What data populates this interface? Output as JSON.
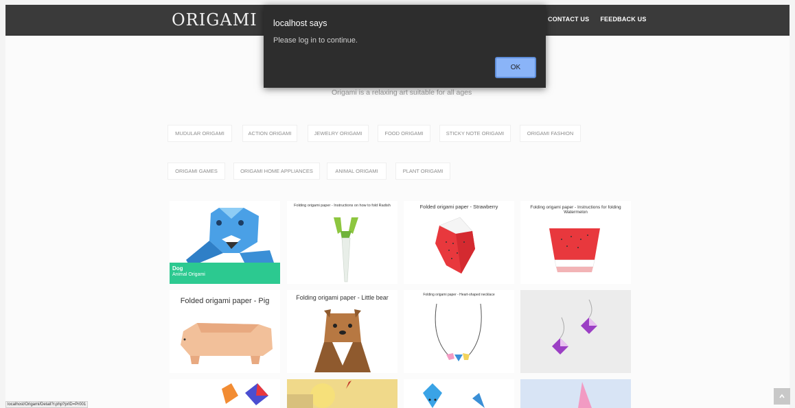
{
  "navbar": {
    "brand": "ORIGAMI",
    "links": [
      "CONTACT US",
      "FEEDBACK US"
    ]
  },
  "subtitle": "Origami is a relaxing art suitable for all ages",
  "categories": {
    "row1": [
      "MUDULAR ORIGAMI",
      "ACTION ORIGAMI",
      "JEWELRY ORIGAMI",
      "FOOD ORIGAMI",
      "STICKY NOTE ORIGAMI",
      "ORIGAMI FASHION"
    ],
    "row2": [
      "ORIGAMI GAMES",
      "ORIGAMI HOME APPLIANCES",
      "ANIMAL ORIGAMI",
      "PLANT ORIGAMI"
    ]
  },
  "cards": {
    "dog": {
      "name": "Dog",
      "category": "Animal Origami"
    },
    "radish": {
      "title": "Folding origami paper - Instructions on how to fold Radish"
    },
    "strawberry": {
      "title": "Folded origami paper - Strawberry"
    },
    "watermelon": {
      "title": "Folding origami paper - Instructions for folding Watermelon"
    },
    "pig": {
      "title": "Folded origami paper - Pig"
    },
    "bear": {
      "title": "Folding origami paper - Little bear"
    },
    "necklace": {
      "title": "Folding origami paper - Heart-shaped necklace"
    }
  },
  "dialog": {
    "title": "localhost says",
    "message": "Please log in to continue.",
    "ok_label": "OK"
  },
  "status_url": "localhost/Origami/Detail?r.php?prID=Pr001",
  "colors": {
    "navbar": "#3a3a3a",
    "caption": "#2cc990",
    "dialog": "#2d2d2d",
    "ok_button": "#8ab4f8"
  },
  "icons": {
    "scroll_top": "chevron-up-icon"
  }
}
